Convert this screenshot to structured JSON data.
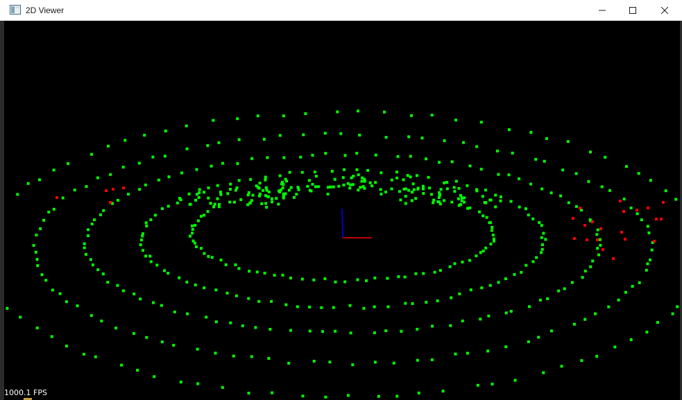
{
  "window": {
    "title": "2D Viewer",
    "icon": "app-window-icon",
    "controls": {
      "minimize_icon": "minimize-icon",
      "maximize_icon": "maximize-icon",
      "close_icon": "close-icon"
    }
  },
  "viewer": {
    "background_color": "#000000",
    "fps_label": "1000.1 FPS",
    "point_colors": {
      "inlier": "#00ff00",
      "outlier": "#ff0000"
    },
    "axis_colors": {
      "x": "#ff0000",
      "z": "#0000ff"
    }
  }
}
